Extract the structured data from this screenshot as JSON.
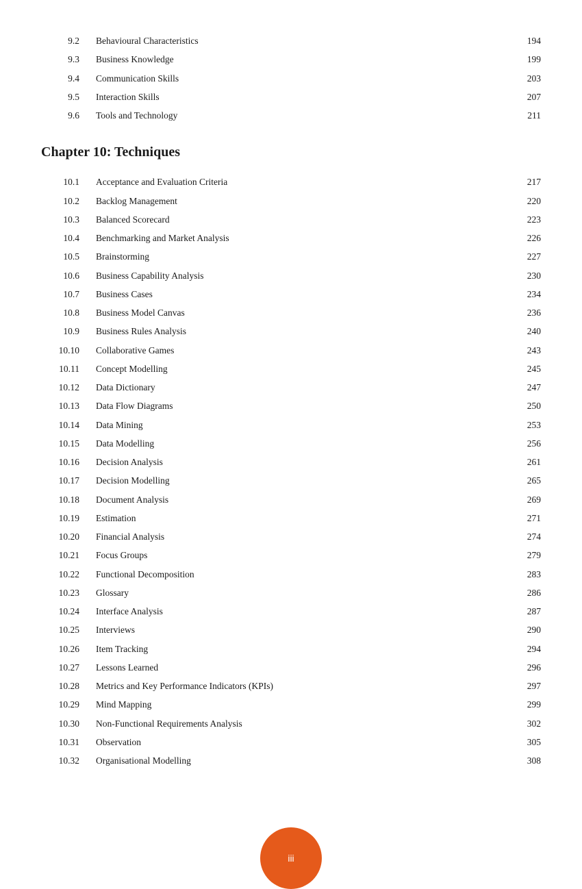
{
  "section9": {
    "entries": [
      {
        "number": "9.2",
        "title": "Behavioural Characteristics",
        "page": "194"
      },
      {
        "number": "9.3",
        "title": "Business Knowledge",
        "page": "199"
      },
      {
        "number": "9.4",
        "title": "Communication Skills",
        "page": "203"
      },
      {
        "number": "9.5",
        "title": "Interaction Skills",
        "page": "207"
      },
      {
        "number": "9.6",
        "title": "Tools and Technology",
        "page": "211"
      }
    ]
  },
  "chapter10": {
    "heading": "Chapter 10: Techniques",
    "entries": [
      {
        "number": "10.1",
        "title": "Acceptance and Evaluation Criteria",
        "page": "217"
      },
      {
        "number": "10.2",
        "title": "Backlog Management",
        "page": "220"
      },
      {
        "number": "10.3",
        "title": "Balanced Scorecard",
        "page": "223"
      },
      {
        "number": "10.4",
        "title": "Benchmarking and Market Analysis",
        "page": "226"
      },
      {
        "number": "10.5",
        "title": "Brainstorming",
        "page": "227"
      },
      {
        "number": "10.6",
        "title": "Business Capability Analysis",
        "page": "230"
      },
      {
        "number": "10.7",
        "title": "Business Cases",
        "page": "234"
      },
      {
        "number": "10.8",
        "title": "Business Model Canvas",
        "page": "236"
      },
      {
        "number": "10.9",
        "title": "Business Rules Analysis",
        "page": "240"
      },
      {
        "number": "10.10",
        "title": "Collaborative Games",
        "page": "243"
      },
      {
        "number": "10.11",
        "title": "Concept Modelling",
        "page": "245"
      },
      {
        "number": "10.12",
        "title": "Data Dictionary",
        "page": "247"
      },
      {
        "number": "10.13",
        "title": "Data Flow Diagrams",
        "page": "250"
      },
      {
        "number": "10.14",
        "title": "Data Mining",
        "page": "253"
      },
      {
        "number": "10.15",
        "title": "Data Modelling",
        "page": "256"
      },
      {
        "number": "10.16",
        "title": "Decision Analysis",
        "page": "261"
      },
      {
        "number": "10.17",
        "title": "Decision Modelling",
        "page": "265"
      },
      {
        "number": "10.18",
        "title": "Document Analysis",
        "page": "269"
      },
      {
        "number": "10.19",
        "title": "Estimation",
        "page": "271"
      },
      {
        "number": "10.20",
        "title": "Financial Analysis",
        "page": "274"
      },
      {
        "number": "10.21",
        "title": "Focus Groups",
        "page": "279"
      },
      {
        "number": "10.22",
        "title": "Functional Decomposition",
        "page": "283"
      },
      {
        "number": "10.23",
        "title": "Glossary",
        "page": "286"
      },
      {
        "number": "10.24",
        "title": "Interface Analysis",
        "page": "287"
      },
      {
        "number": "10.25",
        "title": "Interviews",
        "page": "290"
      },
      {
        "number": "10.26",
        "title": "Item Tracking",
        "page": "294"
      },
      {
        "number": "10.27",
        "title": "Lessons Learned",
        "page": "296"
      },
      {
        "number": "10.28",
        "title": "Metrics and Key Performance Indicators (KPIs)",
        "page": "297"
      },
      {
        "number": "10.29",
        "title": "Mind Mapping",
        "page": "299"
      },
      {
        "number": "10.30",
        "title": "Non-Functional Requirements Analysis",
        "page": "302"
      },
      {
        "number": "10.31",
        "title": "Observation",
        "page": "305"
      },
      {
        "number": "10.32",
        "title": "Organisational Modelling",
        "page": "308"
      }
    ]
  },
  "footer": {
    "page_label": "iii",
    "circle_color": "#E55A1B"
  }
}
